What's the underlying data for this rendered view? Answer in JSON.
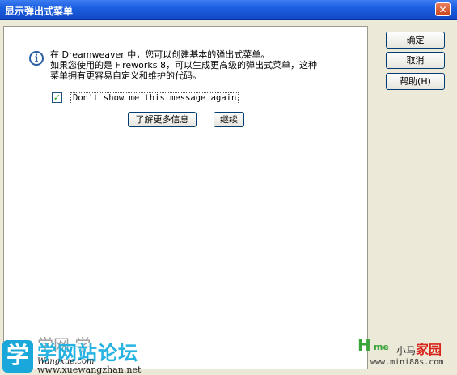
{
  "window": {
    "title": "显示弹出式菜单",
    "close_label": "✕"
  },
  "message": {
    "line1": "在 Dreamweaver 中，您可以创建基本的弹出式菜单。",
    "line2": "如果您使用的是 Fireworks 8，可以生成更高级的弹出式菜单，这种",
    "line3": "菜单拥有更容易自定义和维护的代码。"
  },
  "checkbox": {
    "label": "Don't show me this message again",
    "checked": true,
    "glyph": "✓"
  },
  "buttons": {
    "more_info": "了解更多信息",
    "continue": "继续",
    "ok": "确定",
    "cancel": "取消",
    "help": "帮助(H)"
  },
  "icons": {
    "info": "info-icon"
  },
  "watermark_left": {
    "char": "学",
    "site_cn": "学网站论坛",
    "brand": "学网·学",
    "sub": "Wangxue.com",
    "url": "www.xuewangzhan.net"
  },
  "watermark_right": {
    "logo": "H",
    "logo_text": "me",
    "name_prefix": "小马",
    "name_main": "家园",
    "url": "www.mini88s.com"
  },
  "colors": {
    "titlebar": "#1b5fe0",
    "face": "#ece9d8",
    "button_border": "#003c74"
  }
}
